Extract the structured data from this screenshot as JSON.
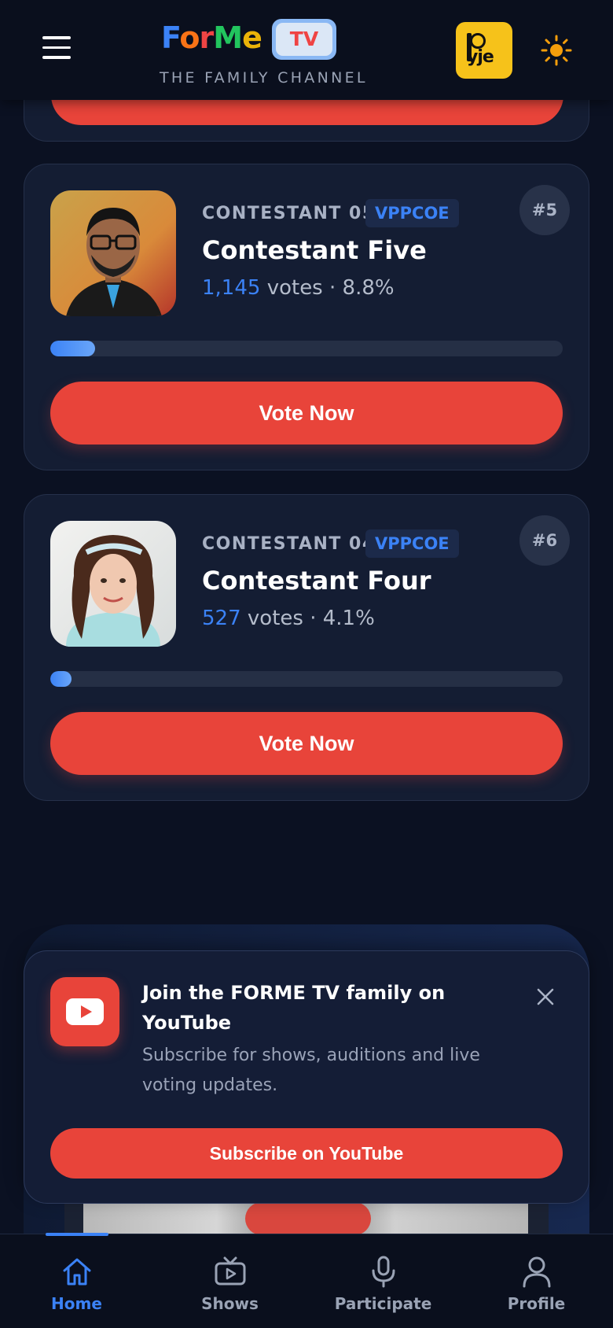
{
  "header": {
    "logo_word_parts": [
      "F",
      "o",
      "r",
      "M",
      "e"
    ],
    "logo_tv": "TV",
    "tagline": "THE FAMILY CHANNEL",
    "badge_text": "yje"
  },
  "contestants": [
    {
      "label": "CONTESTANT 05",
      "tag": "VPPCOE",
      "rank": "#5",
      "name": "Contestant Five",
      "votes": "1,145",
      "votes_suffix": " votes · 8.8%",
      "progress_percent": 8.8,
      "vote_label": "Vote Now"
    },
    {
      "label": "CONTESTANT 04",
      "tag": "VPPCOE",
      "rank": "#6",
      "name": "Contestant Four",
      "votes": "527",
      "votes_suffix": " votes · 4.1%",
      "progress_percent": 4.1,
      "vote_label": "Vote Now"
    }
  ],
  "popup": {
    "title": "Join the FORME TV family on YouTube",
    "subtitle": "Subscribe for shows, auditions and live voting updates.",
    "button": "Subscribe on YouTube"
  },
  "nav": {
    "items": [
      {
        "label": "Home",
        "icon": "home-icon",
        "active": true
      },
      {
        "label": "Shows",
        "icon": "tv-icon",
        "active": false
      },
      {
        "label": "Participate",
        "icon": "microphone-icon",
        "active": false
      },
      {
        "label": "Profile",
        "icon": "user-icon",
        "active": false
      }
    ]
  },
  "colors": {
    "accent": "#3b82f6",
    "vote_red": "#e8443a",
    "background": "#0b1122",
    "card": "#141d33"
  }
}
